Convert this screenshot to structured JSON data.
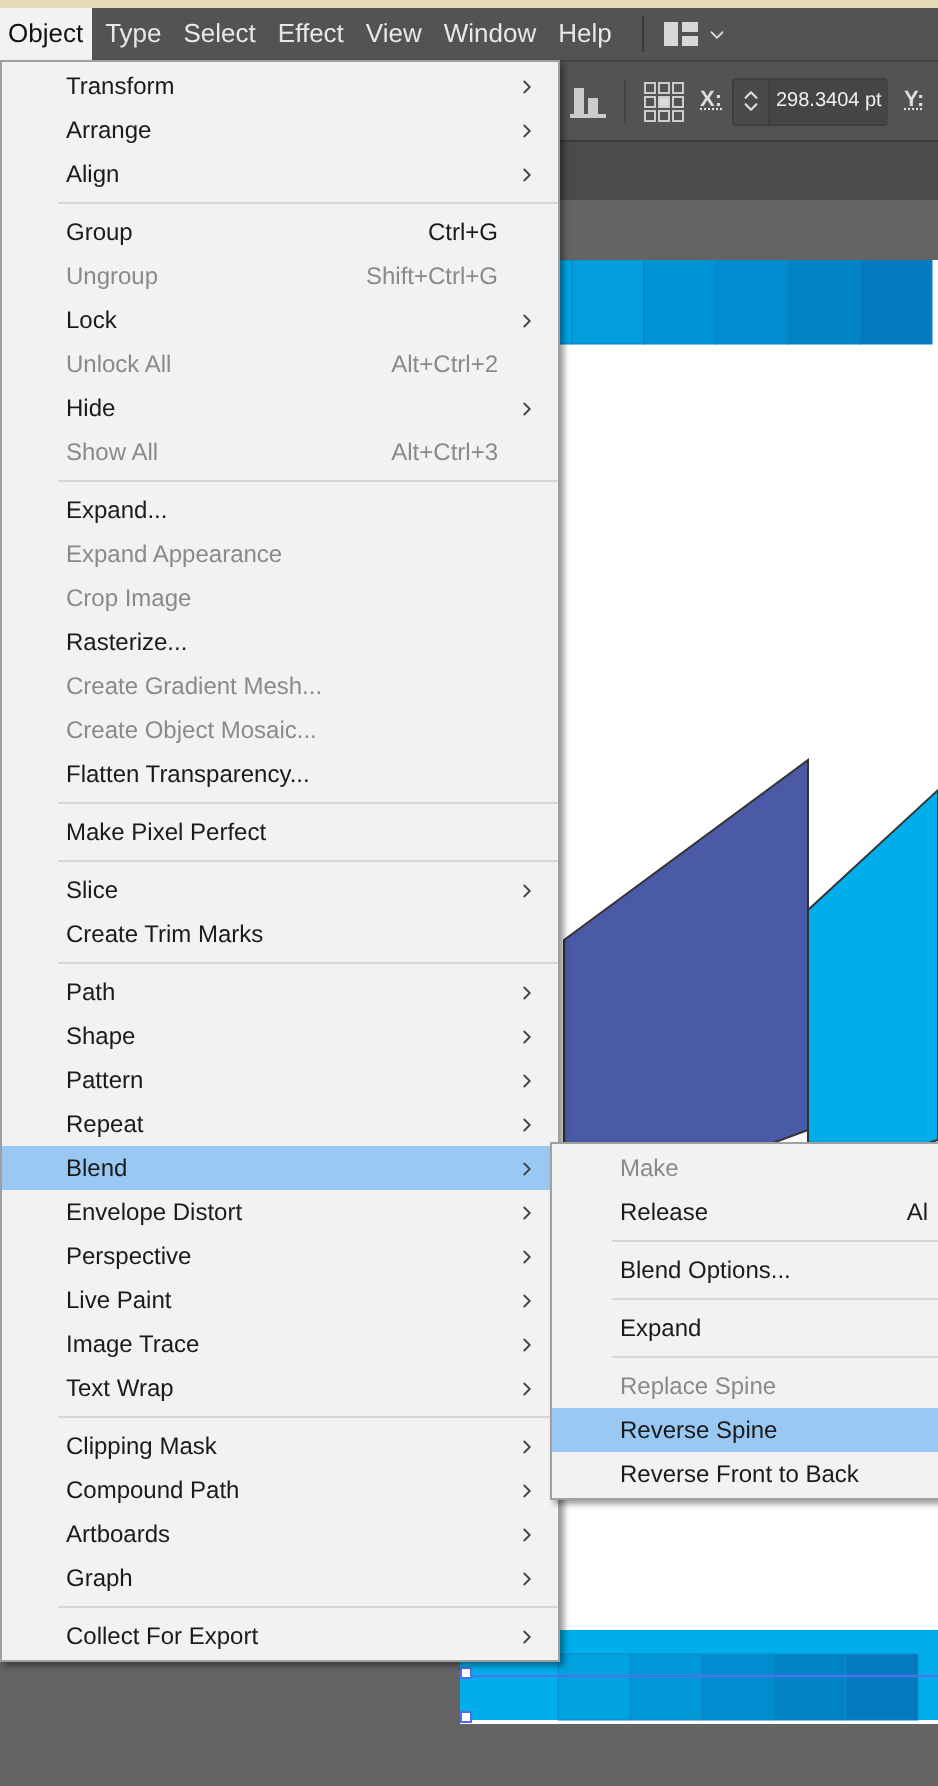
{
  "menubar": [
    {
      "label": "Object",
      "selected": true
    },
    {
      "label": "Type",
      "selected": false
    },
    {
      "label": "Select",
      "selected": false
    },
    {
      "label": "Effect",
      "selected": false
    },
    {
      "label": "View",
      "selected": false
    },
    {
      "label": "Window",
      "selected": false
    },
    {
      "label": "Help",
      "selected": false
    }
  ],
  "control_bar": {
    "x_label": "X:",
    "x_value": "298.3404 pt",
    "y_label": "Y:"
  },
  "object_menu": {
    "sections": [
      [
        {
          "label": "Transform",
          "submenu": true,
          "disabled": false,
          "selected": false
        },
        {
          "label": "Arrange",
          "submenu": true,
          "disabled": false,
          "selected": false
        },
        {
          "label": "Align",
          "submenu": true,
          "disabled": false,
          "selected": false
        }
      ],
      [
        {
          "label": "Group",
          "shortcut": "Ctrl+G",
          "submenu": false,
          "disabled": false,
          "selected": false
        },
        {
          "label": "Ungroup",
          "shortcut": "Shift+Ctrl+G",
          "submenu": false,
          "disabled": true,
          "selected": false
        },
        {
          "label": "Lock",
          "submenu": true,
          "disabled": false,
          "selected": false
        },
        {
          "label": "Unlock All",
          "shortcut": "Alt+Ctrl+2",
          "submenu": false,
          "disabled": true,
          "selected": false
        },
        {
          "label": "Hide",
          "submenu": true,
          "disabled": false,
          "selected": false
        },
        {
          "label": "Show All",
          "shortcut": "Alt+Ctrl+3",
          "submenu": false,
          "disabled": true,
          "selected": false
        }
      ],
      [
        {
          "label": "Expand...",
          "submenu": false,
          "disabled": false,
          "selected": false
        },
        {
          "label": "Expand Appearance",
          "submenu": false,
          "disabled": true,
          "selected": false
        },
        {
          "label": "Crop Image",
          "submenu": false,
          "disabled": true,
          "selected": false
        },
        {
          "label": "Rasterize...",
          "submenu": false,
          "disabled": false,
          "selected": false
        },
        {
          "label": "Create Gradient Mesh...",
          "submenu": false,
          "disabled": true,
          "selected": false
        },
        {
          "label": "Create Object Mosaic...",
          "submenu": false,
          "disabled": true,
          "selected": false
        },
        {
          "label": "Flatten Transparency...",
          "submenu": false,
          "disabled": false,
          "selected": false
        }
      ],
      [
        {
          "label": "Make Pixel Perfect",
          "submenu": false,
          "disabled": false,
          "selected": false
        }
      ],
      [
        {
          "label": "Slice",
          "submenu": true,
          "disabled": false,
          "selected": false
        },
        {
          "label": "Create Trim Marks",
          "submenu": false,
          "disabled": false,
          "selected": false
        }
      ],
      [
        {
          "label": "Path",
          "submenu": true,
          "disabled": false,
          "selected": false
        },
        {
          "label": "Shape",
          "submenu": true,
          "disabled": false,
          "selected": false
        },
        {
          "label": "Pattern",
          "submenu": true,
          "disabled": false,
          "selected": false
        },
        {
          "label": "Repeat",
          "submenu": true,
          "disabled": false,
          "selected": false
        },
        {
          "label": "Blend",
          "submenu": true,
          "disabled": false,
          "selected": true
        },
        {
          "label": "Envelope Distort",
          "submenu": true,
          "disabled": false,
          "selected": false
        },
        {
          "label": "Perspective",
          "submenu": true,
          "disabled": false,
          "selected": false
        },
        {
          "label": "Live Paint",
          "submenu": true,
          "disabled": false,
          "selected": false
        },
        {
          "label": "Image Trace",
          "submenu": true,
          "disabled": false,
          "selected": false
        },
        {
          "label": "Text Wrap",
          "submenu": true,
          "disabled": false,
          "selected": false
        }
      ],
      [
        {
          "label": "Clipping Mask",
          "submenu": true,
          "disabled": false,
          "selected": false
        },
        {
          "label": "Compound Path",
          "submenu": true,
          "disabled": false,
          "selected": false
        },
        {
          "label": "Artboards",
          "submenu": true,
          "disabled": false,
          "selected": false
        },
        {
          "label": "Graph",
          "submenu": true,
          "disabled": false,
          "selected": false
        }
      ],
      [
        {
          "label": "Collect For Export",
          "submenu": true,
          "disabled": false,
          "selected": false
        }
      ]
    ]
  },
  "blend_submenu": {
    "sections": [
      [
        {
          "label": "Make",
          "disabled": true,
          "selected": false
        },
        {
          "label": "Release",
          "shortcut": "Al",
          "disabled": false,
          "selected": false
        }
      ],
      [
        {
          "label": "Blend Options...",
          "disabled": false,
          "selected": false
        }
      ],
      [
        {
          "label": "Expand",
          "disabled": false,
          "selected": false
        }
      ],
      [
        {
          "label": "Replace Spine",
          "disabled": true,
          "selected": false
        },
        {
          "label": "Reverse Spine",
          "disabled": false,
          "selected": true
        },
        {
          "label": "Reverse Front to Back",
          "disabled": false,
          "selected": false
        }
      ]
    ]
  }
}
